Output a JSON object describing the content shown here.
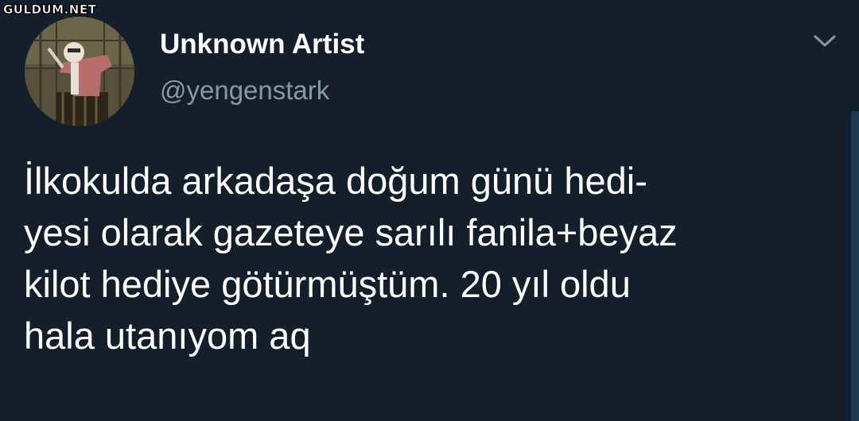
{
  "watermark": "GULDUM.NET",
  "author": {
    "display_name": "Unknown Artist",
    "handle": "@yengenstark"
  },
  "tweet": {
    "lines": [
      "İlkokulda arkadaşa doğum günü hedi-",
      "yesi olarak gazeteye sarılı  fanila+beyaz",
      "kilot hediye götürmüştüm. 20 yıl oldu",
      "hala utanıyom aq"
    ]
  },
  "icons": {
    "menu": "chevron-down-icon"
  },
  "colors": {
    "background": "#151f2b",
    "primary_text": "#ffffff",
    "secondary_text": "#8899a6"
  }
}
